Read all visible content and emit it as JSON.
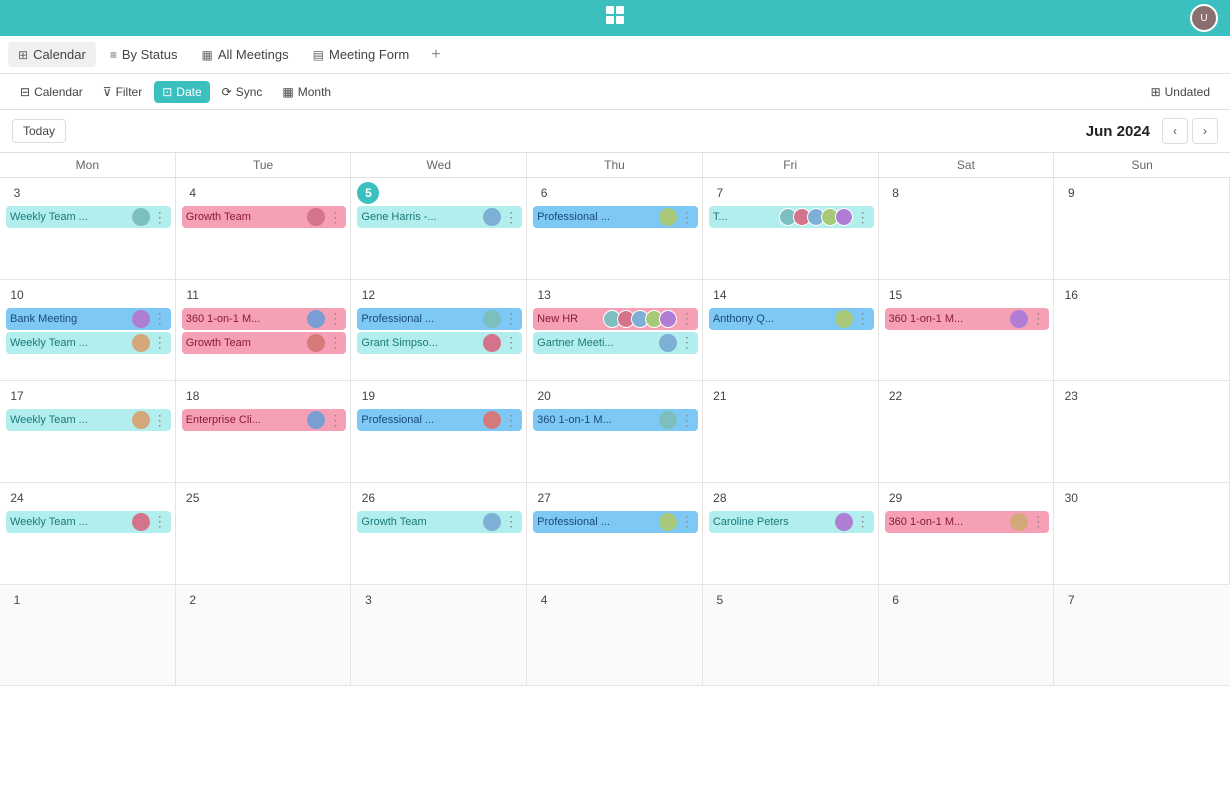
{
  "appBar": {
    "logoText": "⠿",
    "avatarLabel": "U"
  },
  "tabs": [
    {
      "id": "calendar",
      "label": "Calendar",
      "icon": "☰",
      "active": true
    },
    {
      "id": "by-status",
      "label": "By Status",
      "icon": "≡"
    },
    {
      "id": "all-meetings",
      "label": "All Meetings",
      "icon": "▦"
    },
    {
      "id": "meeting-form",
      "label": "Meeting Form",
      "icon": "▤"
    }
  ],
  "toolbar": {
    "calendarLabel": "Calendar",
    "filterLabel": "Filter",
    "dateLabel": "Date",
    "syncLabel": "Sync",
    "monthLabel": "Month",
    "undatedLabel": "Undated"
  },
  "calendar": {
    "todayLabel": "Today",
    "monthTitle": "Jun 2024",
    "daysOfWeek": [
      "Mon",
      "Tue",
      "Wed",
      "Thu",
      "Fri",
      "Sat",
      "Sun"
    ],
    "weeks": [
      {
        "days": [
          {
            "num": "3",
            "isToday": false,
            "isOtherMonth": false,
            "events": [
              {
                "label": "Weekly Team ...",
                "color": "ev-teal",
                "avatar": "👤"
              }
            ]
          },
          {
            "num": "4",
            "isToday": false,
            "isOtherMonth": false,
            "events": [
              {
                "label": "Growth Team",
                "color": "ev-pink",
                "avatar": "👤"
              }
            ]
          },
          {
            "num": "5",
            "isToday": true,
            "isOtherMonth": false,
            "events": [
              {
                "label": "Gene Harris -...",
                "color": "ev-teal",
                "avatar": "👤"
              }
            ]
          },
          {
            "num": "6",
            "isToday": false,
            "isOtherMonth": false,
            "events": [
              {
                "label": "Professional ...",
                "color": "ev-blue",
                "avatar": "👤"
              }
            ]
          },
          {
            "num": "7",
            "isToday": false,
            "isOtherMonth": false,
            "events": [
              {
                "label": "T...",
                "color": "ev-teal",
                "avatarGroup": true
              }
            ]
          },
          {
            "num": "8",
            "isToday": false,
            "isOtherMonth": false,
            "events": []
          },
          {
            "num": "9",
            "isToday": false,
            "isOtherMonth": false,
            "events": []
          }
        ]
      },
      {
        "days": [
          {
            "num": "10",
            "isToday": false,
            "isOtherMonth": false,
            "events": [
              {
                "label": "Bank Meeting",
                "color": "ev-blue",
                "avatar": "👤"
              },
              {
                "label": "Weekly Team ...",
                "color": "ev-teal",
                "avatar": "👤"
              }
            ]
          },
          {
            "num": "11",
            "isToday": false,
            "isOtherMonth": false,
            "events": [
              {
                "label": "360 1-on-1 M...",
                "color": "ev-pink",
                "avatar": "👤"
              },
              {
                "label": "Growth Team",
                "color": "ev-pink",
                "avatar": "👤"
              }
            ]
          },
          {
            "num": "12",
            "isToday": false,
            "isOtherMonth": false,
            "events": [
              {
                "label": "Professional ...",
                "color": "ev-blue",
                "avatar": "👤"
              },
              {
                "label": "Grant Simpso...",
                "color": "ev-teal",
                "avatar": "👤"
              }
            ]
          },
          {
            "num": "13",
            "isToday": false,
            "isOtherMonth": false,
            "events": [
              {
                "label": "New HR",
                "color": "ev-pink",
                "avatarGroup": true
              },
              {
                "label": "Gartner Meeti...",
                "color": "ev-teal",
                "avatar": "👤"
              }
            ]
          },
          {
            "num": "14",
            "isToday": false,
            "isOtherMonth": false,
            "events": [
              {
                "label": "Anthony Q...",
                "color": "ev-blue",
                "avatar": "👤"
              }
            ]
          },
          {
            "num": "15",
            "isToday": false,
            "isOtherMonth": false,
            "events": [
              {
                "label": "360 1-on-1 M...",
                "color": "ev-pink",
                "avatar": "👤"
              }
            ]
          },
          {
            "num": "16",
            "isToday": false,
            "isOtherMonth": false,
            "events": []
          }
        ]
      },
      {
        "days": [
          {
            "num": "17",
            "isToday": false,
            "isOtherMonth": false,
            "events": [
              {
                "label": "Weekly Team ...",
                "color": "ev-teal",
                "avatar": "👤"
              }
            ]
          },
          {
            "num": "18",
            "isToday": false,
            "isOtherMonth": false,
            "events": [
              {
                "label": "Enterprise Cli...",
                "color": "ev-pink",
                "avatar": "👤"
              }
            ]
          },
          {
            "num": "19",
            "isToday": false,
            "isOtherMonth": false,
            "events": [
              {
                "label": "Professional ...",
                "color": "ev-blue",
                "avatar": "👤"
              }
            ]
          },
          {
            "num": "20",
            "isToday": false,
            "isOtherMonth": false,
            "events": [
              {
                "label": "360 1-on-1 M...",
                "color": "ev-blue",
                "avatar": "👤"
              }
            ]
          },
          {
            "num": "21",
            "isToday": false,
            "isOtherMonth": false,
            "events": []
          },
          {
            "num": "22",
            "isToday": false,
            "isOtherMonth": false,
            "events": []
          },
          {
            "num": "23",
            "isToday": false,
            "isOtherMonth": false,
            "events": []
          }
        ]
      },
      {
        "days": [
          {
            "num": "24",
            "isToday": false,
            "isOtherMonth": false,
            "events": [
              {
                "label": "Weekly Team ...",
                "color": "ev-teal",
                "avatar": "👤"
              }
            ]
          },
          {
            "num": "25",
            "isToday": false,
            "isOtherMonth": false,
            "events": []
          },
          {
            "num": "26",
            "isToday": false,
            "isOtherMonth": false,
            "events": [
              {
                "label": "Growth Team",
                "color": "ev-teal",
                "avatar": "👤"
              }
            ]
          },
          {
            "num": "27",
            "isToday": false,
            "isOtherMonth": false,
            "events": [
              {
                "label": "Professional ...",
                "color": "ev-blue",
                "avatar": "👤"
              }
            ]
          },
          {
            "num": "28",
            "isToday": false,
            "isOtherMonth": false,
            "events": [
              {
                "label": "Caroline Peters",
                "color": "ev-teal",
                "avatar": "👤"
              }
            ]
          },
          {
            "num": "29",
            "isToday": false,
            "isOtherMonth": false,
            "events": [
              {
                "label": "360 1-on-1 M...",
                "color": "ev-pink",
                "avatar": "👤"
              }
            ]
          },
          {
            "num": "30",
            "isToday": false,
            "isOtherMonth": false,
            "events": []
          }
        ]
      },
      {
        "days": [
          {
            "num": "1",
            "isToday": false,
            "isOtherMonth": true,
            "events": []
          },
          {
            "num": "2",
            "isToday": false,
            "isOtherMonth": true,
            "events": []
          },
          {
            "num": "3",
            "isToday": false,
            "isOtherMonth": true,
            "events": []
          },
          {
            "num": "4",
            "isToday": false,
            "isOtherMonth": true,
            "events": []
          },
          {
            "num": "5",
            "isToday": false,
            "isOtherMonth": true,
            "events": []
          },
          {
            "num": "6",
            "isToday": false,
            "isOtherMonth": true,
            "events": []
          },
          {
            "num": "7",
            "isToday": false,
            "isOtherMonth": true,
            "events": []
          }
        ]
      }
    ]
  }
}
